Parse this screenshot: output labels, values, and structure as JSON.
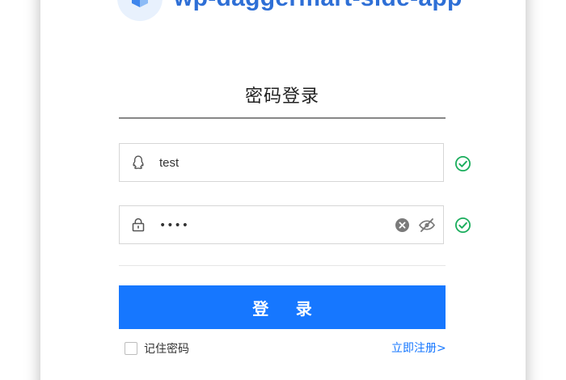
{
  "brand": {
    "title": "wp-daggermart-side-app",
    "logo_icon": "cube-icon",
    "accent_color": "#2e6fd6"
  },
  "login": {
    "tab_title": "密码登录",
    "username": {
      "value": "test",
      "icon": "qq-penguin-icon",
      "valid": true
    },
    "password": {
      "masked_value": "••••",
      "icon": "lock-icon",
      "valid": true
    },
    "submit_label": "登 录",
    "remember_label": "记住密码",
    "remember_checked": false,
    "register_label": "立即注册>",
    "button_color": "#1677ff",
    "valid_color": "#1aad5c"
  }
}
